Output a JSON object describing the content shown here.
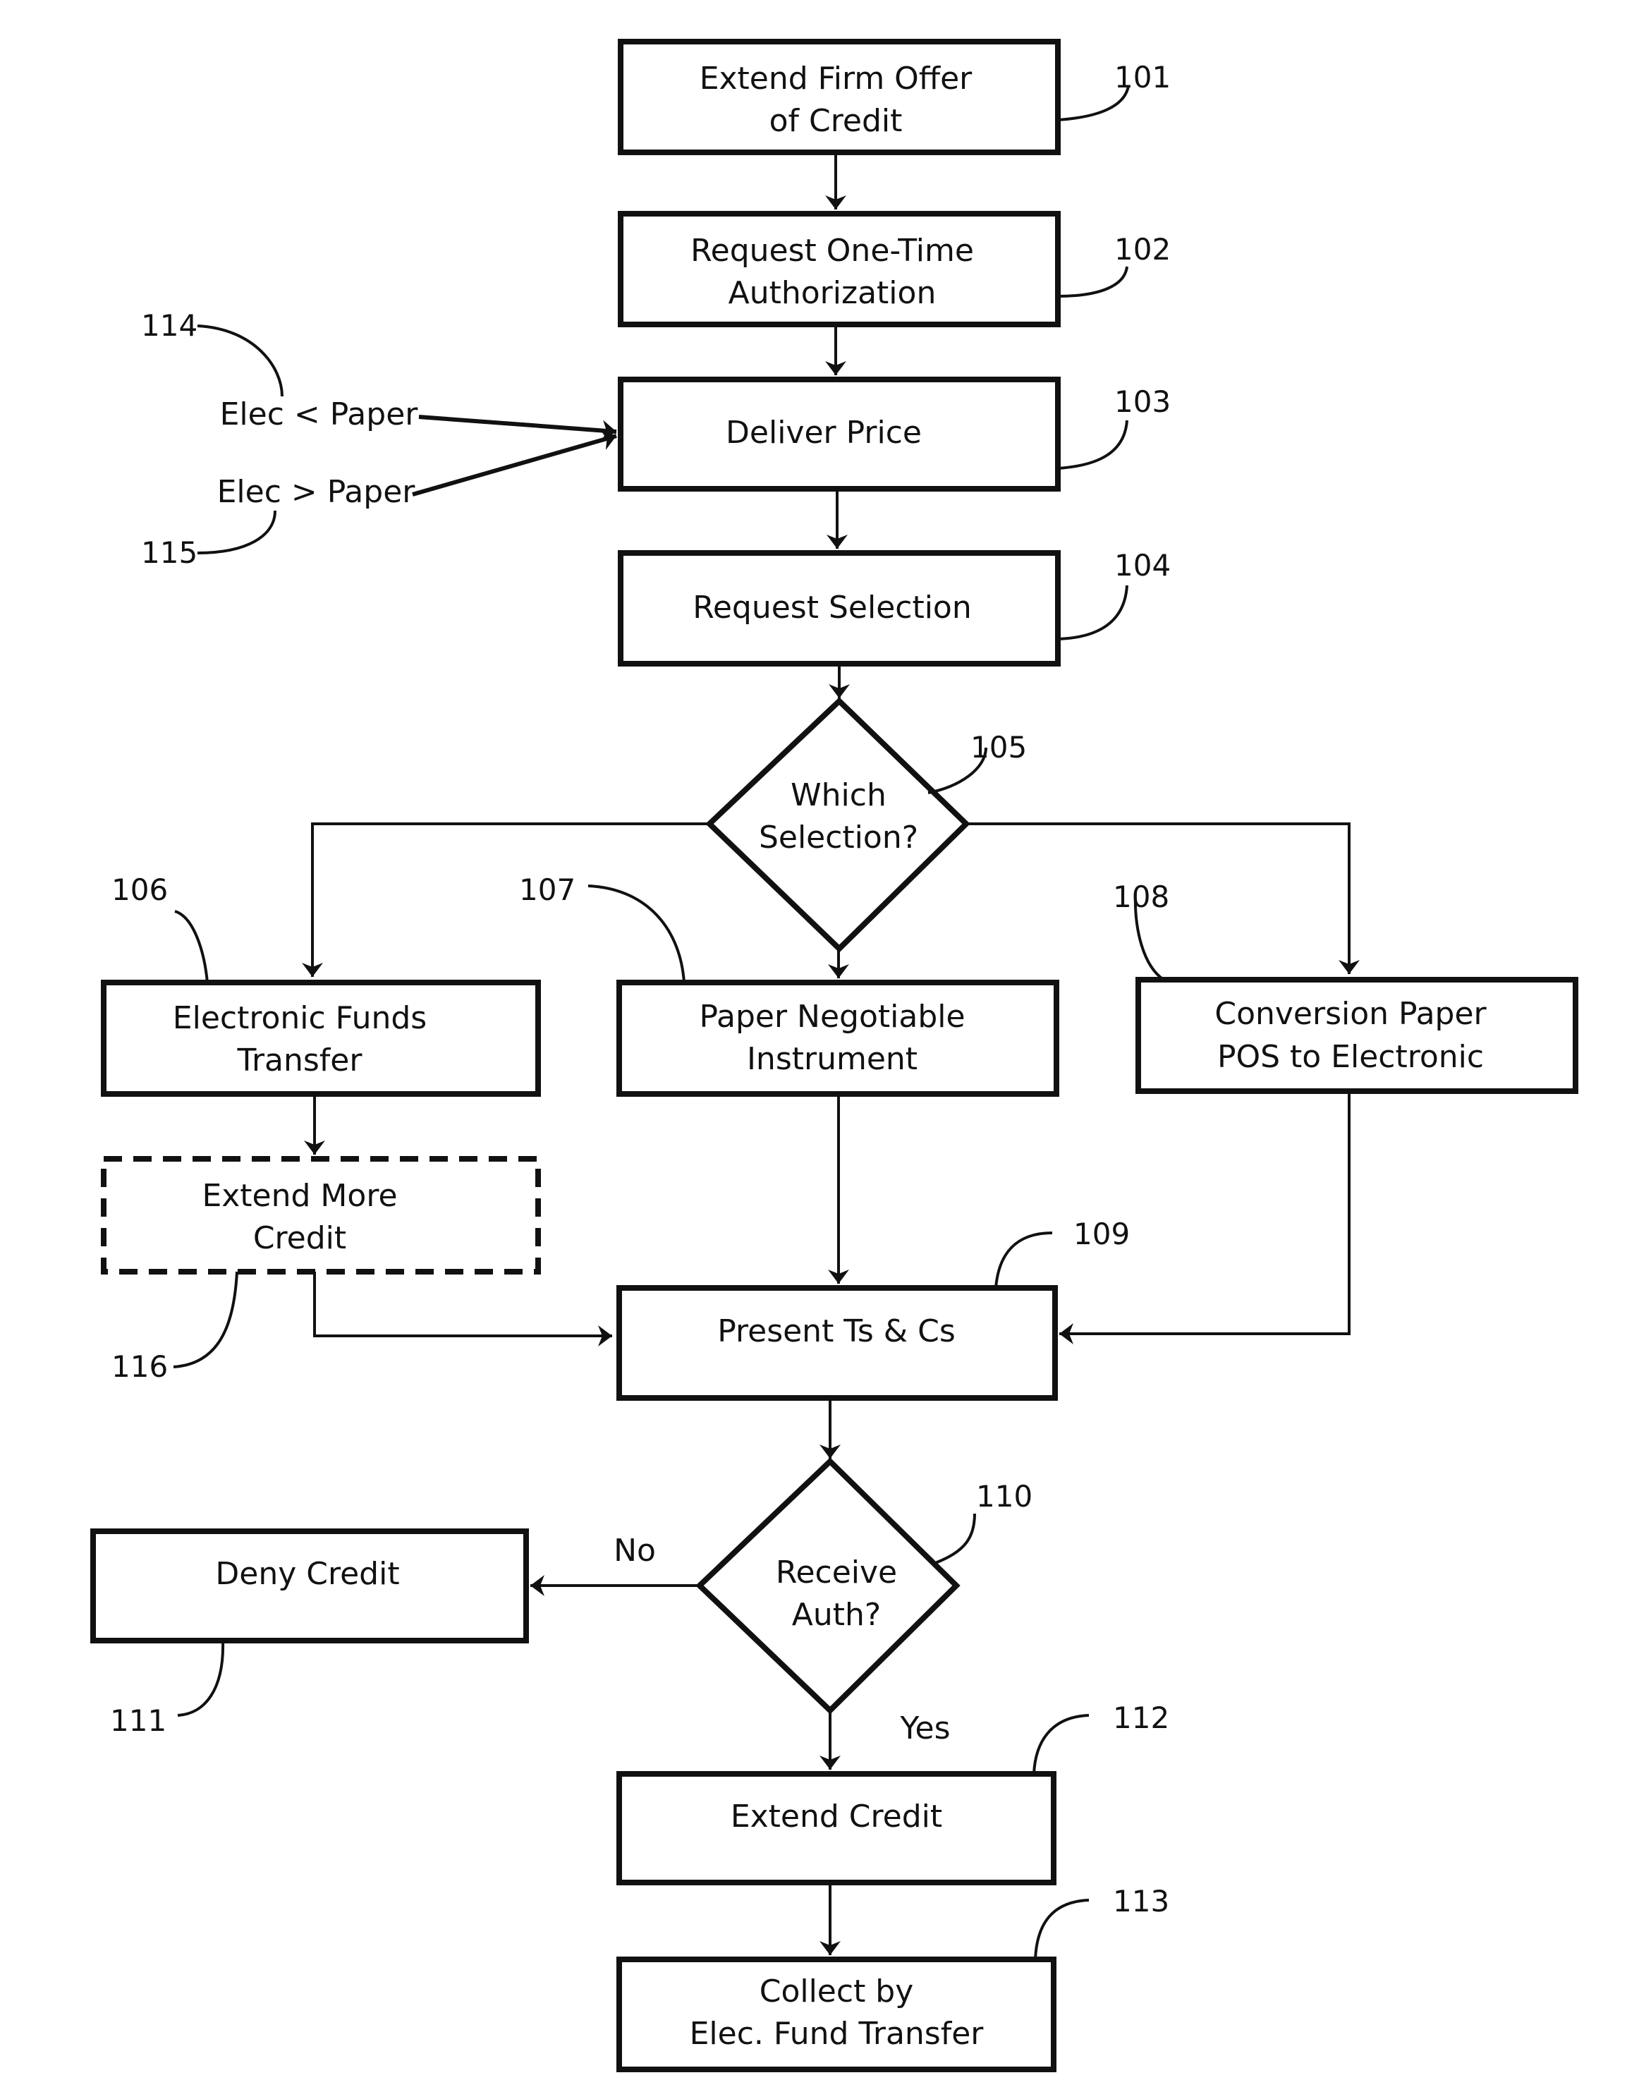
{
  "diagram": {
    "type": "flowchart",
    "nodes": {
      "n101": {
        "ref": "101",
        "shape": "process",
        "lines": [
          "Extend Firm Offer",
          "of Credit"
        ]
      },
      "n102": {
        "ref": "102",
        "shape": "process",
        "lines": [
          "Request One-Time",
          "Authorization"
        ]
      },
      "n103": {
        "ref": "103",
        "shape": "process",
        "lines": [
          "Deliver Price"
        ]
      },
      "n104": {
        "ref": "104",
        "shape": "process",
        "lines": [
          "Request Selection"
        ]
      },
      "n105": {
        "ref": "105",
        "shape": "decision",
        "lines": [
          "Which",
          "Selection?"
        ]
      },
      "n106": {
        "ref": "106",
        "shape": "process",
        "lines": [
          "Electronic Funds",
          "Transfer"
        ]
      },
      "n107": {
        "ref": "107",
        "shape": "process",
        "lines": [
          "Paper Negotiable",
          "Instrument"
        ]
      },
      "n108": {
        "ref": "108",
        "shape": "process",
        "lines": [
          "Conversion Paper",
          "POS to Electronic"
        ]
      },
      "n116": {
        "ref": "116",
        "shape": "optional-process",
        "lines": [
          "Extend More",
          "Credit"
        ]
      },
      "n109": {
        "ref": "109",
        "shape": "process",
        "lines": [
          "Present Ts & Cs"
        ]
      },
      "n110": {
        "ref": "110",
        "shape": "decision",
        "lines": [
          "Receive",
          "Auth?"
        ]
      },
      "n111": {
        "ref": "111",
        "shape": "process",
        "lines": [
          "Deny Credit"
        ]
      },
      "n112": {
        "ref": "112",
        "shape": "process",
        "lines": [
          "Extend Credit"
        ]
      },
      "n113": {
        "ref": "113",
        "shape": "process",
        "lines": [
          "Collect by",
          "Elec. Fund Transfer"
        ]
      }
    },
    "inputs": {
      "i114": {
        "ref": "114",
        "text": "Elec < Paper"
      },
      "i115": {
        "ref": "115",
        "text": "Elec > Paper"
      }
    },
    "edge_labels": {
      "no": "No",
      "yes": "Yes"
    },
    "edges": [
      {
        "from": "101",
        "to": "102"
      },
      {
        "from": "102",
        "to": "103"
      },
      {
        "from": "114",
        "to": "103"
      },
      {
        "from": "115",
        "to": "103"
      },
      {
        "from": "103",
        "to": "104"
      },
      {
        "from": "104",
        "to": "105"
      },
      {
        "from": "105",
        "to": "106"
      },
      {
        "from": "105",
        "to": "107"
      },
      {
        "from": "105",
        "to": "108"
      },
      {
        "from": "106",
        "to": "116"
      },
      {
        "from": "116",
        "to": "109"
      },
      {
        "from": "107",
        "to": "109"
      },
      {
        "from": "108",
        "to": "109"
      },
      {
        "from": "109",
        "to": "110"
      },
      {
        "from": "110",
        "to": "111",
        "label": "No"
      },
      {
        "from": "110",
        "to": "112",
        "label": "Yes"
      },
      {
        "from": "112",
        "to": "113"
      }
    ]
  }
}
